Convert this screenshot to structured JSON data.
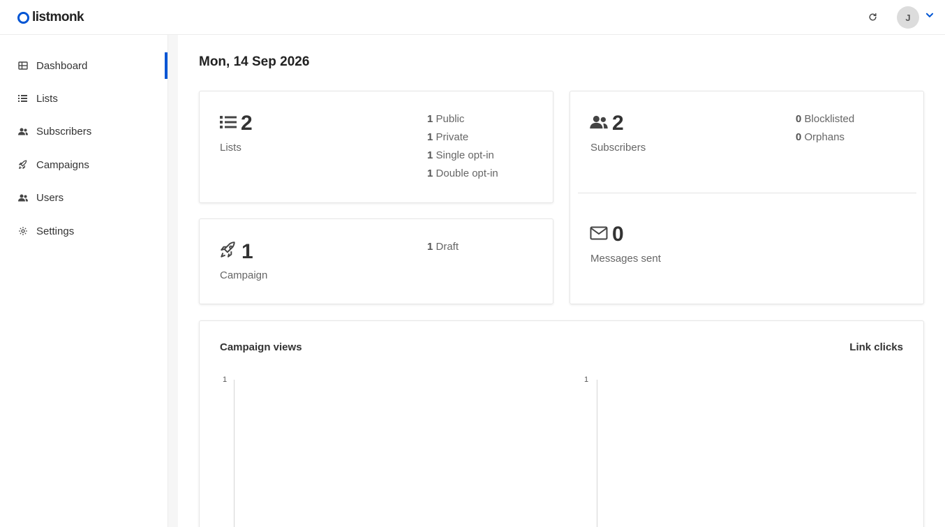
{
  "header": {
    "app_name": "listmonk",
    "avatar_initial": "J"
  },
  "icons": {
    "logo": "listmonk-ring-logo",
    "refresh": "refresh-icon",
    "user_menu": "chevron-down-icon"
  },
  "colors": {
    "accent": "#0055d4",
    "text": "#333333",
    "muted": "#666666"
  },
  "sidebar": {
    "items": [
      {
        "label": "Dashboard",
        "icon": "dashboard-icon",
        "active": true
      },
      {
        "label": "Lists",
        "icon": "list-icon"
      },
      {
        "label": "Subscribers",
        "icon": "users-icon"
      },
      {
        "label": "Campaigns",
        "icon": "rocket-icon"
      },
      {
        "label": "Users",
        "icon": "users-icon"
      },
      {
        "label": "Settings",
        "icon": "gear-icon"
      }
    ]
  },
  "main": {
    "date": "Mon, 14 Sep 2026",
    "lists": {
      "count": "2",
      "label": "Lists",
      "breakdown": [
        {
          "num": "1",
          "label": "Public"
        },
        {
          "num": "1",
          "label": "Private"
        },
        {
          "num": "1",
          "label": "Single opt-in"
        },
        {
          "num": "1",
          "label": "Double opt-in"
        }
      ]
    },
    "subscribers": {
      "count": "2",
      "label": "Subscribers",
      "breakdown": [
        {
          "num": "0",
          "label": "Blocklisted"
        },
        {
          "num": "0",
          "label": "Orphans"
        }
      ]
    },
    "campaigns": {
      "count": "1",
      "label": "Campaign",
      "breakdown": [
        {
          "num": "1",
          "label": "Draft"
        }
      ]
    },
    "messages": {
      "count": "0",
      "label": "Messages sent"
    },
    "charts": {
      "views_title": "Campaign views",
      "clicks_title": "Link clicks",
      "views_ymax": "1",
      "clicks_ymax": "1"
    }
  }
}
